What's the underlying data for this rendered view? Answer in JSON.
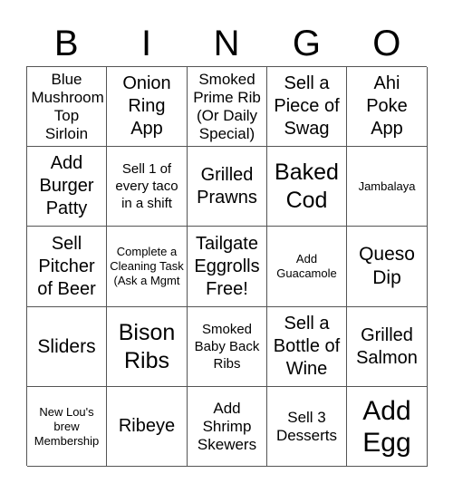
{
  "header": {
    "letters": [
      "B",
      "I",
      "N",
      "G",
      "O"
    ]
  },
  "cells": [
    [
      "Blue Mushroom Top Sirloin",
      "Onion Ring App",
      "Smoked Prime Rib (Or Daily Special)",
      "Sell a Piece of Swag",
      "Ahi Poke App"
    ],
    [
      "Add Burger Patty",
      "Sell 1 of every taco in a shift",
      "Grilled Prawns",
      "Baked Cod",
      "Jambalaya"
    ],
    [
      "Sell Pitcher of Beer",
      "Complete a Cleaning Task (Ask a Mgmt",
      "Tailgate Eggrolls Free!",
      "Add Guacamole",
      "Queso Dip"
    ],
    [
      "Sliders",
      "Bison Ribs",
      "Smoked Baby Back Ribs",
      "Sell a Bottle of Wine",
      "Grilled Salmon"
    ],
    [
      "New Lou's brew Membership",
      "Ribeye",
      "Add Shrimp Skewers",
      "Sell 3 Desserts",
      "Add Egg"
    ]
  ],
  "colors": {
    "grid_line": "#555555",
    "text": "#000000",
    "background": "#ffffff"
  }
}
